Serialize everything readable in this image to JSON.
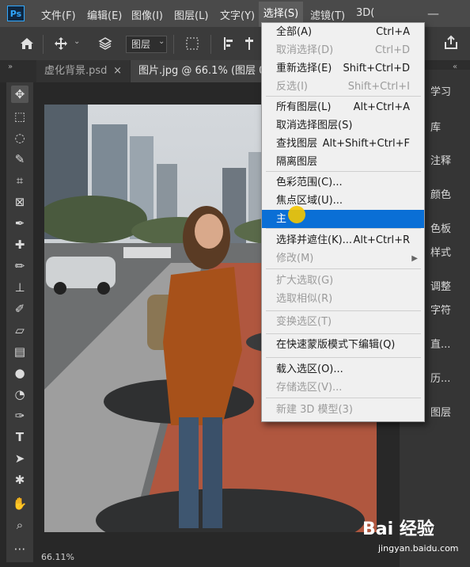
{
  "app": {
    "logo": "Ps"
  },
  "menubar": [
    {
      "label": "文件(F)"
    },
    {
      "label": "编辑(E)"
    },
    {
      "label": "图像(I)"
    },
    {
      "label": "图层(L)"
    },
    {
      "label": "文字(Y)"
    },
    {
      "label": "选择(S)"
    },
    {
      "label": "滤镜(T)"
    },
    {
      "label": "3D("
    }
  ],
  "options_bar": {
    "layer_dropdown": "图层"
  },
  "tabs": [
    {
      "label": "虚化背景.psd",
      "close": "×"
    },
    {
      "label": "图片.jpg @ 66.1% (图层 0"
    }
  ],
  "canvas": {
    "zoom": "66.11%"
  },
  "right_panel": [
    "学习",
    "库",
    "注释",
    "颜色",
    "色板",
    "样式",
    "调整",
    "字符",
    "直...",
    "历...",
    "图层"
  ],
  "select_menu": {
    "items": [
      {
        "label": "全部(A)",
        "shortcut": "Ctrl+A",
        "state": "enabled"
      },
      {
        "label": "取消选择(D)",
        "shortcut": "Ctrl+D",
        "state": "disabled"
      },
      {
        "label": "重新选择(E)",
        "shortcut": "Shift+Ctrl+D",
        "state": "enabled"
      },
      {
        "label": "反选(I)",
        "shortcut": "Shift+Ctrl+I",
        "state": "disabled"
      },
      {
        "label": "所有图层(L)",
        "shortcut": "Alt+Ctrl+A",
        "state": "enabled"
      },
      {
        "label": "取消选择图层(S)",
        "shortcut": "",
        "state": "enabled"
      },
      {
        "label": "查找图层",
        "shortcut": "Alt+Shift+Ctrl+F",
        "state": "enabled"
      },
      {
        "label": "隔离图层",
        "shortcut": "",
        "state": "enabled"
      },
      {
        "label": "色彩范围(C)...",
        "shortcut": "",
        "state": "enabled"
      },
      {
        "label": "焦点区域(U)...",
        "shortcut": "",
        "state": "enabled"
      },
      {
        "label": "主",
        "shortcut": "",
        "state": "highlighted"
      },
      {
        "label": "选择并遮住(K)...",
        "shortcut": "Alt+Ctrl+R",
        "state": "enabled"
      },
      {
        "label": "修改(M)",
        "shortcut": "",
        "state": "disabled",
        "submenu": true
      },
      {
        "label": "扩大选取(G)",
        "shortcut": "",
        "state": "disabled"
      },
      {
        "label": "选取相似(R)",
        "shortcut": "",
        "state": "disabled"
      },
      {
        "label": "变换选区(T)",
        "shortcut": "",
        "state": "disabled"
      },
      {
        "label": "在快速蒙版模式下编辑(Q)",
        "shortcut": "",
        "state": "enabled"
      },
      {
        "label": "载入选区(O)...",
        "shortcut": "",
        "state": "enabled"
      },
      {
        "label": "存储选区(V)...",
        "shortcut": "",
        "state": "disabled"
      },
      {
        "label": "新建 3D 模型(3)",
        "shortcut": "",
        "state": "disabled"
      }
    ]
  },
  "watermark": {
    "brand": "Bai 经验",
    "url": "jingyan.baidu.com"
  },
  "colors": {
    "menu_highlight": "#0a6fd6",
    "menu_bg": "#f0f0f0",
    "app_bg": "#282828"
  }
}
